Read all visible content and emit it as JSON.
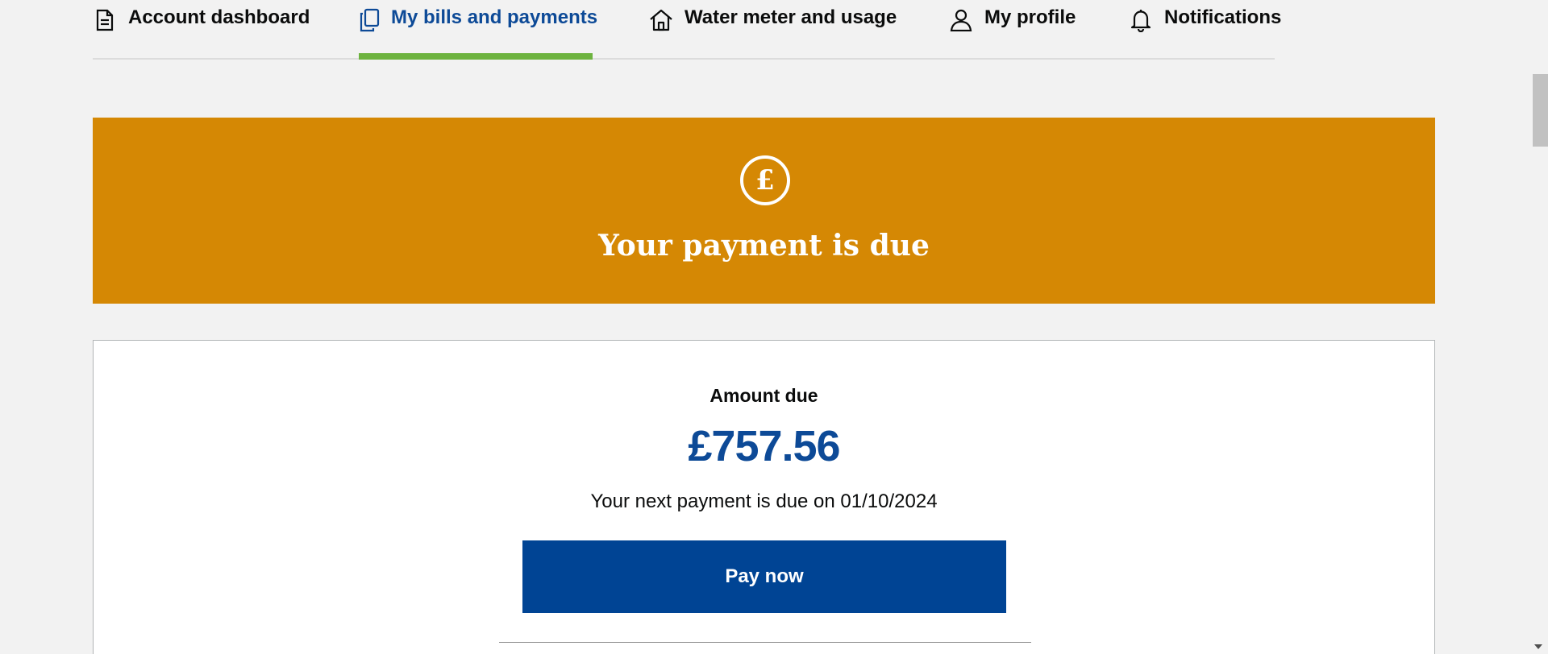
{
  "nav": {
    "tabs": [
      {
        "label": "Account dashboard",
        "icon": "document-icon"
      },
      {
        "label": "My bills and payments",
        "icon": "copy-icon",
        "active": true
      },
      {
        "label": "Water meter and usage",
        "icon": "home-icon"
      },
      {
        "label": "My profile",
        "icon": "user-icon"
      },
      {
        "label": "Notifications",
        "icon": "bell-icon"
      }
    ]
  },
  "banner": {
    "icon_symbol": "£",
    "title": "Your payment is due"
  },
  "card": {
    "amount_label": "Amount due",
    "amount_value": "£757.56",
    "next_due": "Your next payment is due on 01/10/2024",
    "pay_button": "Pay now"
  },
  "colors": {
    "banner": "#d58804",
    "accent_blue": "#004494",
    "active_tab_text": "#0d4a97",
    "active_tab_underline": "#6db33f"
  }
}
